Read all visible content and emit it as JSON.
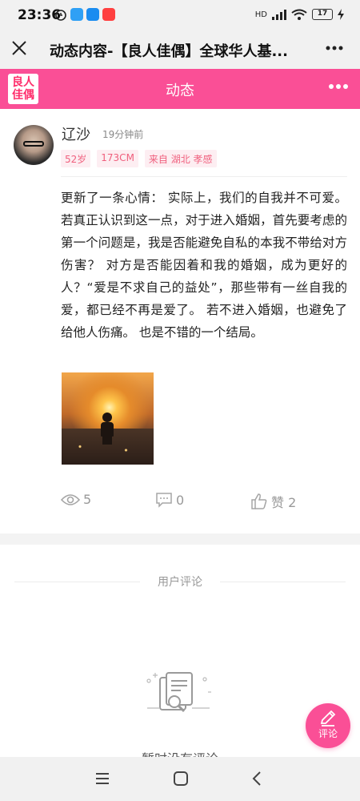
{
  "status_bar": {
    "time": "23:36",
    "network": "HD",
    "battery": "17"
  },
  "title_bar": {
    "close_icon": "close-icon",
    "title": "动态内容-【良人佳偶】全球华人基...",
    "more_icon": "more-icon"
  },
  "header": {
    "logo_line1": "良人",
    "logo_line2": "佳偶",
    "title": "动态",
    "more_icon": "more-dots-icon",
    "color": "#fa4f96"
  },
  "post": {
    "author": "辽沙",
    "time": "19分钟前",
    "tags": [
      "52岁",
      "173CM",
      "来自 湖北 孝感"
    ],
    "body": "更新了一条心情： 实际上，我们的自我并不可爱。 若真正认识到这一点，对于进入婚姻，首先要考虑的第一个问题是，我是否能避免自私的本我不带给对方伤害？ 对方是否能因着和我的婚姻，成为更好的人？“爱是不求自己的益处”，那些带有一丝自我的爱，都已经不再是爱了。 若不进入婚姻，也避免了给他人伤痛。 也是不错的一个结局。",
    "stats": {
      "views": "5",
      "comments": "0",
      "likes": "赞 2"
    }
  },
  "comments": {
    "title": "用户评论",
    "empty_text": "暂时没有评论"
  },
  "fab": {
    "label": "评论"
  }
}
